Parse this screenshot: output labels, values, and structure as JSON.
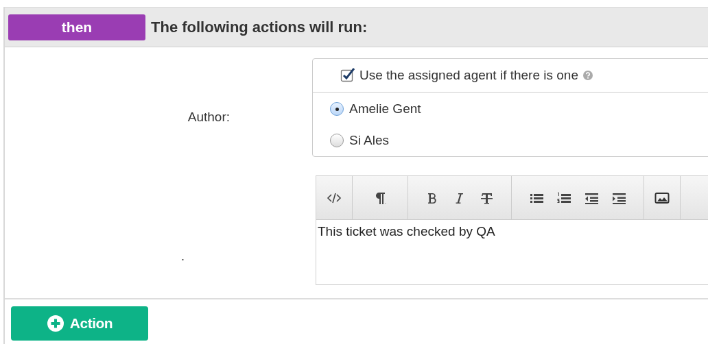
{
  "header": {
    "badge": "then",
    "title": "The following actions will run:"
  },
  "author": {
    "label": "Author:",
    "use_assigned": {
      "label": "Use the assigned agent if there is one",
      "checked": true
    },
    "options": [
      {
        "label": "Amelie Gent",
        "selected": true
      },
      {
        "label": "Si Ales",
        "selected": false
      }
    ]
  },
  "message": {
    "label": ".",
    "text": "This ticket was checked by QA"
  },
  "add_button": {
    "label": "Action"
  }
}
